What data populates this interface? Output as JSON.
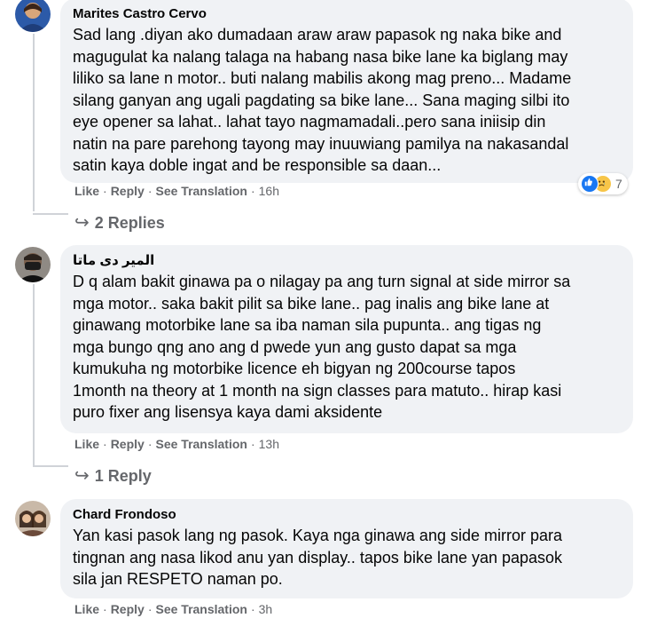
{
  "comments": [
    {
      "author": "Marites Castro Cervo",
      "lines": [
        "Sad lang .diyan ako dumadaan araw araw papasok ng naka bike and",
        "magugulat ka nalang talaga na habang nasa bike lane ka biglang may",
        "liliko sa lane n motor.. buti nalang mabilis akong mag preno... Madame",
        "silang ganyan ang ugali pagdating sa bike lane... Sana maging silbi ito",
        "eye opener sa lahat.. lahat tayo nagmamadali..pero sana iniisip din",
        "natin na pare parehong tayong may inuuwiang pamilya na nakasandal",
        "satin kaya doble ingat and be responsible sa daan..."
      ],
      "like": "Like",
      "reply": "Reply",
      "translate": "See Translation",
      "time": "16h",
      "reaction_count": "7",
      "replies": "2 Replies"
    },
    {
      "author": "المير دی ماتا",
      "lines": [
        "D q alam bakit ginawa pa o nilagay pa ang turn signal at side mirror sa",
        "mga motor.. saka bakit pilit sa bike lane.. pag inalis ang bike lane at",
        "ginawang motorbike lane sa iba naman sila pupunta.. ang tigas ng",
        "mga bungo qng ano ang d pwede yun ang gusto dapat sa mga",
        "kumukuha ng motorbike licence eh bigyan ng 200course tapos",
        "1month na theory at 1 month na sign classes para matuto.. hirap kasi",
        "puro fixer ang lisensya kaya dami aksidente"
      ],
      "like": "Like",
      "reply": "Reply",
      "translate": "See Translation",
      "time": "13h",
      "replies": "1 Reply"
    },
    {
      "author": "Chard Frondoso",
      "lines": [
        "Yan kasi pasok lang ng pasok. Kaya nga ginawa ang side mirror para",
        "tingnan ang nasa likod anu yan display.. tapos bike lane yan papasok",
        "sila jan RESPETO naman po."
      ],
      "like": "Like",
      "reply": "Reply",
      "translate": "See Translation",
      "time": "3h"
    }
  ],
  "colors": {
    "bubble": "#f0f2f5",
    "secondary_text": "#65676b",
    "like_blue": "#1877f2",
    "sad_yellow": "#f7c548"
  },
  "icons": {
    "reply_arrow": "↪",
    "like_reaction": "like-icon",
    "sad_reaction": "sad-icon"
  }
}
